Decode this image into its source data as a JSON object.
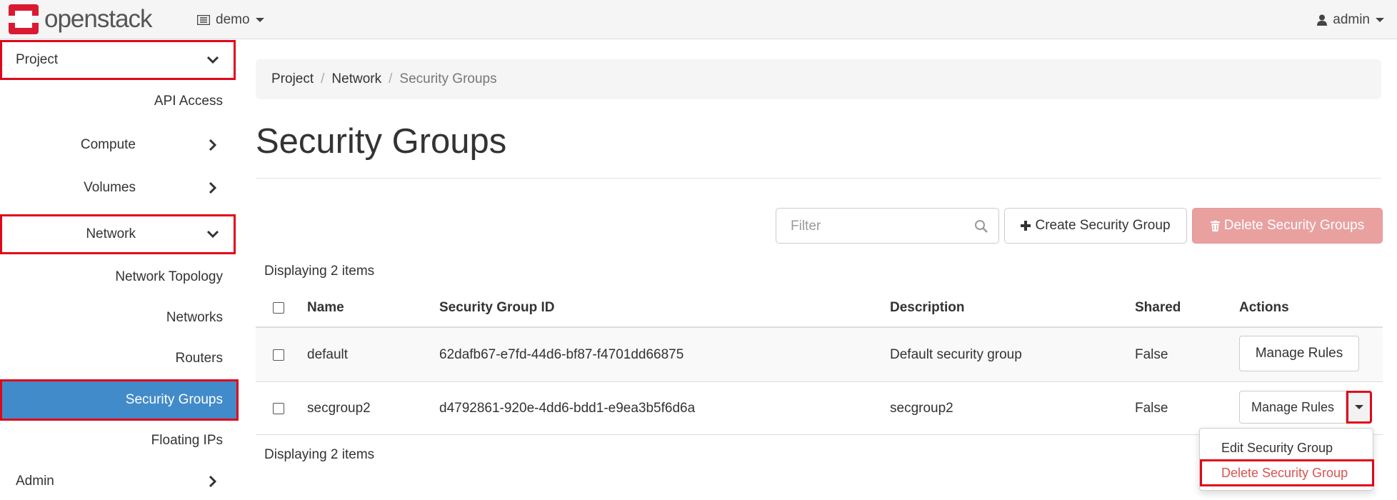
{
  "brand": {
    "name": "openstack",
    "color": "#da1a32"
  },
  "topbar": {
    "project_label": "demo",
    "user_label": "admin"
  },
  "sidebar": {
    "project": "Project",
    "api_access": "API Access",
    "compute": "Compute",
    "volumes": "Volumes",
    "network": "Network",
    "network_topology": "Network Topology",
    "networks": "Networks",
    "routers": "Routers",
    "security_groups": "Security Groups",
    "floating_ips": "Floating IPs",
    "admin": "Admin",
    "active_color": "#428bca",
    "highlight_color": "#e0061a"
  },
  "breadcrumb": {
    "items": [
      "Project",
      "Network"
    ],
    "current": "Security Groups"
  },
  "page_title": "Security Groups",
  "toolbar": {
    "filter_placeholder": "Filter",
    "create_label": "Create Security Group",
    "delete_label": "Delete Security Groups"
  },
  "table": {
    "count_text": "Displaying 2 items",
    "headers": {
      "name": "Name",
      "id": "Security Group ID",
      "description": "Description",
      "shared": "Shared",
      "actions": "Actions"
    },
    "rows": [
      {
        "name": "default",
        "id": "62dafb67-e7fd-44d6-bf87-f4701dd66875",
        "description": "Default security group",
        "shared": "False",
        "action": "Manage Rules"
      },
      {
        "name": "secgroup2",
        "id": "d4792861-920e-4dd6-bdd1-e9ea3b5f6d6a",
        "description": "secgroup2",
        "shared": "False",
        "action": "Manage Rules"
      }
    ]
  },
  "dropdown": {
    "edit": "Edit Security Group",
    "delete": "Delete Security Group"
  }
}
